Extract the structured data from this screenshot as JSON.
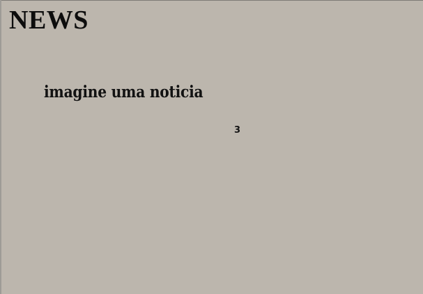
{
  "header": {
    "title": "NEWS"
  },
  "article": {
    "headline": "imagine uma noticia",
    "counter": "3"
  }
}
